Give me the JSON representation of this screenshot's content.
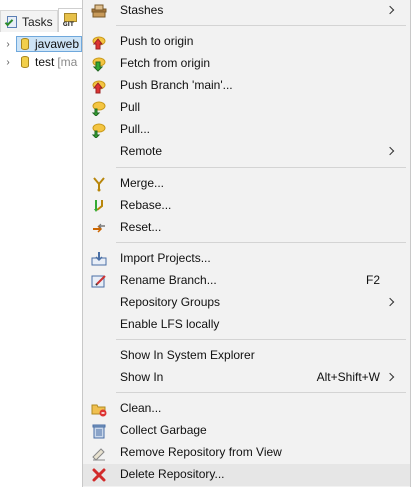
{
  "background": {
    "tabs": [
      {
        "label": "Tasks",
        "icon": "tasks-icon"
      },
      {
        "label": "",
        "icon": "git-repositories-icon",
        "icon_text": "GIT"
      }
    ],
    "tree": [
      {
        "name": "javaweb",
        "branch": "",
        "expander": "›",
        "selected": true
      },
      {
        "name": "test",
        "branch": "[ma",
        "expander": "›",
        "selected": false
      }
    ]
  },
  "menu": {
    "items": [
      {
        "label": "Stashes",
        "icon": "stashes-icon",
        "submenu": true
      },
      {
        "label": "Push to origin",
        "icon": "push-icon"
      },
      {
        "label": "Fetch from origin",
        "icon": "fetch-icon"
      },
      {
        "label": "Push Branch 'main'...",
        "icon": "push-branch-icon"
      },
      {
        "label": "Pull",
        "icon": "pull-icon"
      },
      {
        "label": "Pull...",
        "icon": "pull-dialog-icon"
      },
      {
        "label": "Remote",
        "icon": "",
        "submenu": true
      },
      {
        "label": "Merge...",
        "icon": "merge-icon"
      },
      {
        "label": "Rebase...",
        "icon": "rebase-icon"
      },
      {
        "label": "Reset...",
        "icon": "reset-icon"
      },
      {
        "label": "Import Projects...",
        "icon": "import-projects-icon"
      },
      {
        "label": "Rename Branch...",
        "icon": "rename-branch-icon",
        "accelerator": "F2"
      },
      {
        "label": "Repository Groups",
        "icon": "",
        "submenu": true
      },
      {
        "label": "Enable LFS locally",
        "icon": ""
      },
      {
        "label": "Show In System Explorer",
        "icon": ""
      },
      {
        "label": "Show In",
        "icon": "",
        "accelerator": "Alt+Shift+W",
        "submenu": true
      },
      {
        "label": "Clean...",
        "icon": "clean-icon"
      },
      {
        "label": "Collect Garbage",
        "icon": "collect-garbage-icon"
      },
      {
        "label": "Remove Repository from View",
        "icon": "remove-repository-icon"
      },
      {
        "label": "Delete Repository...",
        "icon": "delete-repository-icon",
        "hovered": true
      }
    ]
  },
  "colors": {
    "menu_background": "#f2f2f2",
    "hover_background": "#e6e6e6",
    "selection": "#cde4f7",
    "delete_red": "#d22b2b"
  }
}
